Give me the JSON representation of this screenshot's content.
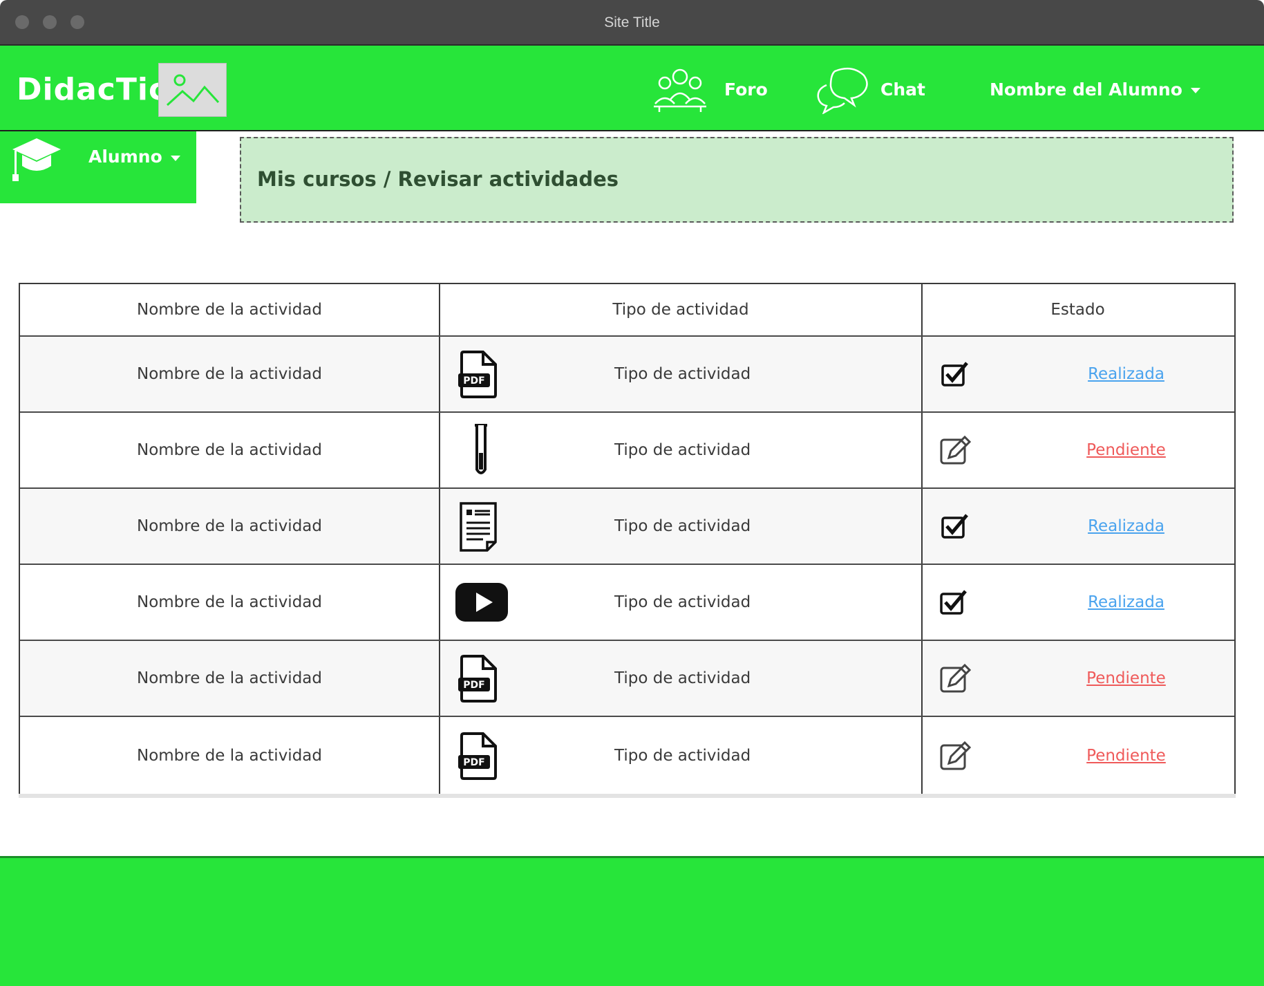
{
  "window": {
    "title": "Site Title"
  },
  "header": {
    "brand": "DidacTic",
    "nav": {
      "foro": "Foro",
      "chat": "Chat",
      "user": "Nombre del Alumno"
    }
  },
  "sidebar": {
    "role": "Alumno"
  },
  "breadcrumb": "Mis cursos / Revisar actividades",
  "table": {
    "columns": [
      "Nombre de la actividad",
      "Tipo de actividad",
      "Estado"
    ],
    "rows": [
      {
        "name": "Nombre de la actividad",
        "type": "Tipo de actividad",
        "type_icon": "pdf-icon",
        "status": "Realizada",
        "status_icon": "checkbox-checked-icon"
      },
      {
        "name": "Nombre de la actividad",
        "type": "Tipo de actividad",
        "type_icon": "test-tube-icon",
        "status": "Pendiente",
        "status_icon": "edit-icon"
      },
      {
        "name": "Nombre de la actividad",
        "type": "Tipo de actividad",
        "type_icon": "document-icon",
        "status": "Realizada",
        "status_icon": "checkbox-checked-icon"
      },
      {
        "name": "Nombre de la actividad",
        "type": "Tipo de actividad",
        "type_icon": "video-play-icon",
        "status": "Realizada",
        "status_icon": "checkbox-checked-icon"
      },
      {
        "name": "Nombre de la actividad",
        "type": "Tipo de actividad",
        "type_icon": "pdf-icon",
        "status": "Pendiente",
        "status_icon": "edit-icon"
      },
      {
        "name": "Nombre de la actividad",
        "type": "Tipo de actividad",
        "type_icon": "pdf-icon",
        "status": "Pendiente",
        "status_icon": "edit-icon"
      }
    ]
  },
  "colors": {
    "brand_green": "#27e53a",
    "breadcrumb_bg": "#cbeccc",
    "done": "#4aa3ee",
    "pending": "#ef5a5a"
  }
}
